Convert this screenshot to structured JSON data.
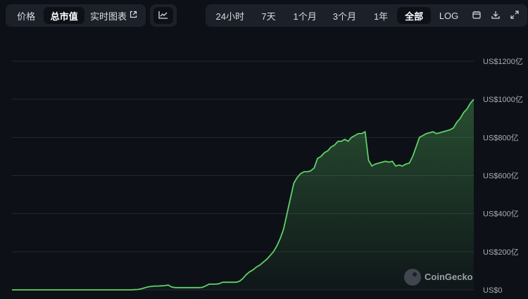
{
  "left_tabs": [
    {
      "label": "价格",
      "active": false
    },
    {
      "label": "总市值",
      "active": true
    },
    {
      "label": "实时图表",
      "active": false,
      "icon": "external-link-icon"
    }
  ],
  "chart_type_button": {
    "icon": "line-chart-icon"
  },
  "range_tabs": [
    {
      "label": "24小时",
      "active": false
    },
    {
      "label": "7天",
      "active": false
    },
    {
      "label": "1个月",
      "active": false
    },
    {
      "label": "3个月",
      "active": false
    },
    {
      "label": "1年",
      "active": false
    },
    {
      "label": "全部",
      "active": true
    },
    {
      "label": "LOG",
      "active": false
    }
  ],
  "tool_icons": [
    "calendar-icon",
    "download-icon",
    "expand-icon"
  ],
  "watermark": "CoinGecko",
  "colors": {
    "line": "#5fd068",
    "background": "#0d1117",
    "grid": "#232830",
    "button_bg": "#1c2129"
  },
  "chart_data": {
    "type": "area",
    "title": "",
    "xlabel": "",
    "ylabel": "",
    "ylim": [
      0,
      1200
    ],
    "y_unit_note": "US$亿",
    "ytick_values": [
      0,
      200,
      400,
      600,
      800,
      1000,
      1200
    ],
    "ytick_labels": [
      "US$0",
      "US$200亿",
      "US$400亿",
      "US$600亿",
      "US$800亿",
      "US$1000亿",
      "US$1200亿"
    ],
    "grid": true,
    "series": [
      {
        "values": [
          0,
          0,
          0,
          0,
          0,
          0,
          0,
          0,
          0,
          0,
          0,
          0,
          0,
          0,
          0,
          0,
          0,
          0,
          0,
          0,
          0,
          0,
          0,
          0,
          0,
          0,
          0,
          0,
          0,
          0,
          0,
          0,
          0,
          0,
          0,
          0,
          1,
          2,
          5,
          10,
          15,
          18,
          20,
          20,
          21,
          22,
          25,
          15,
          12,
          12,
          12,
          12,
          12,
          12,
          12,
          12,
          13,
          20,
          30,
          30,
          30,
          32,
          40,
          40,
          40,
          40,
          40,
          45,
          60,
          80,
          95,
          105,
          120,
          130,
          145,
          160,
          180,
          200,
          230,
          270,
          320,
          400,
          480,
          560,
          590,
          610,
          620,
          620,
          625,
          640,
          690,
          700,
          720,
          730,
          750,
          760,
          780,
          780,
          790,
          780,
          800,
          810,
          820,
          820,
          830,
          680,
          650,
          660,
          665,
          670,
          675,
          670,
          675,
          650,
          655,
          650,
          660,
          665,
          700,
          750,
          800,
          810,
          820,
          825,
          830,
          820,
          825,
          830,
          835,
          840,
          850,
          880,
          900,
          930,
          950,
          980,
          1000
        ]
      }
    ]
  }
}
